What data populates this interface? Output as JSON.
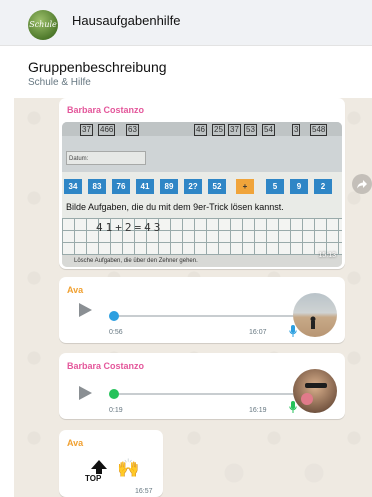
{
  "header": {
    "avatar_text": "Schule",
    "title": "Hausaufgabenhilfe"
  },
  "description": {
    "title": "Gruppenbeschreibung",
    "subtitle": "Schule & Hilfe"
  },
  "messages": [
    {
      "type": "image",
      "sender": "Barbara Costanzo",
      "time": "15:13",
      "image": {
        "top_numbers": [
          "37",
          "466",
          "63",
          "46",
          "25",
          "37",
          "53",
          "54",
          "3",
          "548"
        ],
        "date_label": "Datum:",
        "number_boxes": [
          "34",
          "83",
          "76",
          "41",
          "89",
          "2?",
          "52",
          "+",
          "5",
          "9",
          "2"
        ],
        "task_text": "Bilde Aufgaben, die du mit dem 9er-Trick lösen kannst.",
        "handwritten": "41+2=43",
        "bottom_text": "Lösche Aufgaben, die über den Zehner gehen."
      }
    },
    {
      "type": "voice",
      "sender": "Ava",
      "duration": "0:56",
      "time": "16:07",
      "progress": 0.0,
      "dot_color": "#2c9fe0"
    },
    {
      "type": "voice",
      "sender": "Barbara Costanzo",
      "duration": "0:19",
      "time": "16:19",
      "progress": 0.0,
      "dot_color": "#25c25a"
    },
    {
      "type": "emoji",
      "sender": "Ava",
      "top_label": "TOP",
      "time": "16:57"
    }
  ],
  "icons": {
    "share": "share-icon",
    "play": "play-icon",
    "mic": "microphone-icon"
  },
  "colors": {
    "sender_pink": "#e4579b",
    "sender_orange": "#f0a030",
    "chat_bg": "#efeae2",
    "mic_green": "#25c25a",
    "mic_blue": "#2c9fe0"
  }
}
